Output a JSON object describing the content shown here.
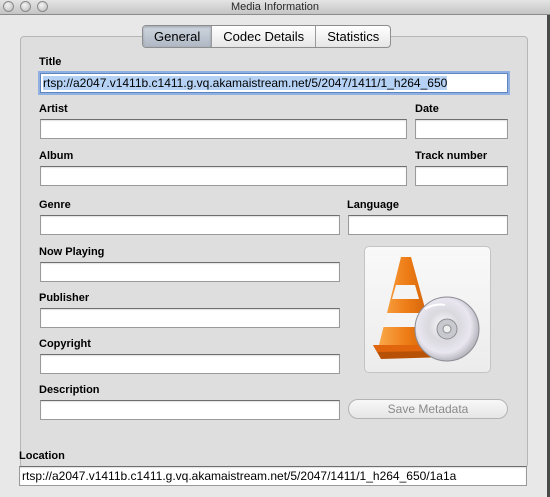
{
  "window": {
    "title": "Media Information"
  },
  "tabs": [
    {
      "label": "General",
      "selected": true
    },
    {
      "label": "Codec Details",
      "selected": false
    },
    {
      "label": "Statistics",
      "selected": false
    }
  ],
  "fields": {
    "title": {
      "label": "Title",
      "value": "rtsp://a2047.v1411b.c1411.g.vq.akamaistream.net/5/2047/1411/1_h264_650"
    },
    "artist": {
      "label": "Artist",
      "value": ""
    },
    "date": {
      "label": "Date",
      "value": ""
    },
    "album": {
      "label": "Album",
      "value": ""
    },
    "track_number": {
      "label": "Track number",
      "value": ""
    },
    "genre": {
      "label": "Genre",
      "value": ""
    },
    "language": {
      "label": "Language",
      "value": ""
    },
    "now_playing": {
      "label": "Now Playing",
      "value": ""
    },
    "publisher": {
      "label": "Publisher",
      "value": ""
    },
    "copyright": {
      "label": "Copyright",
      "value": ""
    },
    "description": {
      "label": "Description",
      "value": ""
    }
  },
  "save_button": {
    "label": "Save Metadata",
    "enabled": false
  },
  "artwork": {
    "icon": "vlc-cone-with-disc-icon"
  },
  "location": {
    "label": "Location",
    "value": "rtsp://a2047.v1411b.c1411.g.vq.akamaistream.net/5/2047/1411/1_h264_650/1a1a"
  },
  "colors": {
    "selection": "#b5d2f4",
    "focus_ring": "#8fb0e0",
    "cone_orange": "#e8700e"
  }
}
